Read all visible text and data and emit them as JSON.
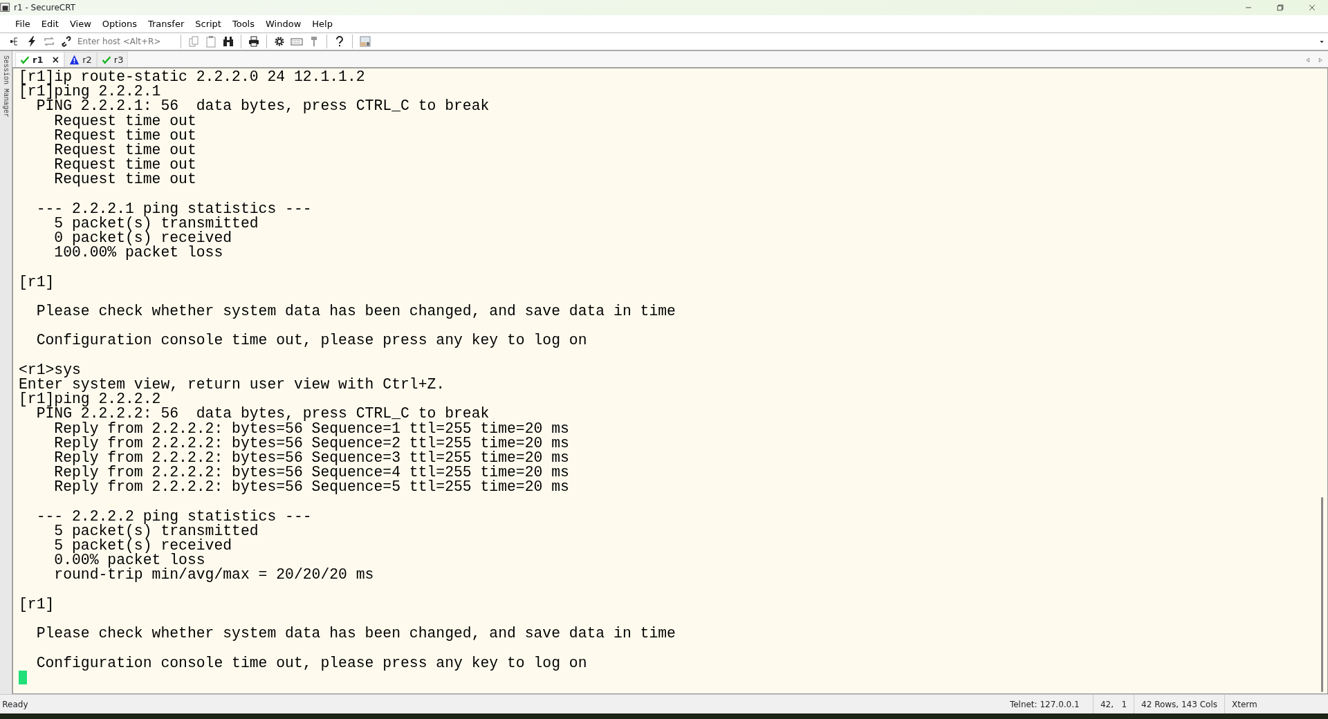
{
  "window": {
    "title": "r1 - SecureCRT"
  },
  "menu": [
    "File",
    "Edit",
    "View",
    "Options",
    "Transfer",
    "Script",
    "Tools",
    "Window",
    "Help"
  ],
  "toolbar": {
    "host_placeholder": "Enter host <Alt+R>"
  },
  "side_panel": {
    "label": "Session Manager"
  },
  "tabs": [
    {
      "label": "r1",
      "connected": true,
      "selected": true,
      "close": "×"
    },
    {
      "label": "r2",
      "connected": false,
      "selected": false
    },
    {
      "label": "r3",
      "connected": true,
      "selected": false
    }
  ],
  "terminal": {
    "lines": [
      {
        "kind": "text",
        "text": "[r1]ip route-static 2.2.2.0 24 12.1.1.2"
      },
      {
        "kind": "text",
        "text": "[r1]ping 2.2.2.1"
      },
      {
        "kind": "text",
        "text": "  PING 2.2.2.1: 56  data bytes, press CTRL_C to break"
      },
      {
        "kind": "text",
        "text": "    Request time out"
      },
      {
        "kind": "text",
        "text": "    Request time out"
      },
      {
        "kind": "text",
        "text": "    Request time out"
      },
      {
        "kind": "text",
        "text": "    Request time out"
      },
      {
        "kind": "text",
        "text": "    Request time out"
      },
      {
        "kind": "blank"
      },
      {
        "kind": "text",
        "text": "  --- 2.2.2.1 ping statistics ---"
      },
      {
        "kind": "text",
        "text": "    5 packet(s) transmitted"
      },
      {
        "kind": "text",
        "text": "    0 packet(s) received"
      },
      {
        "kind": "text",
        "text": "    100.00% packet loss"
      },
      {
        "kind": "blank"
      },
      {
        "kind": "text",
        "text": "[r1]"
      },
      {
        "kind": "blank"
      },
      {
        "kind": "text",
        "text": "  Please check whether system data has been changed, and save data in time"
      },
      {
        "kind": "blank"
      },
      {
        "kind": "text",
        "text": "  Configuration console time out, please press any key to log on"
      },
      {
        "kind": "blank"
      },
      {
        "kind": "text",
        "text": "<r1>sys"
      },
      {
        "kind": "text",
        "text": "Enter system view, return user view with Ctrl+Z."
      },
      {
        "kind": "text",
        "text": "[r1]ping 2.2.2.2"
      },
      {
        "kind": "text",
        "text": "  PING 2.2.2.2: 56  data bytes, press CTRL_C to break"
      },
      {
        "kind": "text",
        "text": "    Reply from 2.2.2.2: bytes=56 Sequence=1 ttl=255 time=20 ms"
      },
      {
        "kind": "text",
        "text": "    Reply from 2.2.2.2: bytes=56 Sequence=2 ttl=255 time=20 ms"
      },
      {
        "kind": "text",
        "text": "    Reply from 2.2.2.2: bytes=56 Sequence=3 ttl=255 time=20 ms"
      },
      {
        "kind": "text",
        "text": "    Reply from 2.2.2.2: bytes=56 Sequence=4 ttl=255 time=20 ms"
      },
      {
        "kind": "text",
        "text": "    Reply from 2.2.2.2: bytes=56 Sequence=5 ttl=255 time=20 ms"
      },
      {
        "kind": "blank"
      },
      {
        "kind": "text",
        "text": "  --- 2.2.2.2 ping statistics ---"
      },
      {
        "kind": "text",
        "text": "    5 packet(s) transmitted"
      },
      {
        "kind": "text",
        "text": "    5 packet(s) received"
      },
      {
        "kind": "text",
        "text": "    0.00% packet loss"
      },
      {
        "kind": "text",
        "text": "    round-trip min/avg/max = 20/20/20 ms"
      },
      {
        "kind": "blank"
      },
      {
        "kind": "text",
        "text": "[r1]"
      },
      {
        "kind": "blank"
      },
      {
        "kind": "text",
        "text": "  Please check whether system data has been changed, and save data in time"
      },
      {
        "kind": "blank"
      },
      {
        "kind": "text",
        "text": "  Configuration console time out, please press any key to log on"
      },
      {
        "kind": "cursor"
      }
    ]
  },
  "status_bar": {
    "message": "Ready",
    "connection": "Telnet: 127.0.0.1",
    "position": "42,   1",
    "size": "42 Rows, 143 Cols",
    "terminal_type": "Xterm"
  }
}
